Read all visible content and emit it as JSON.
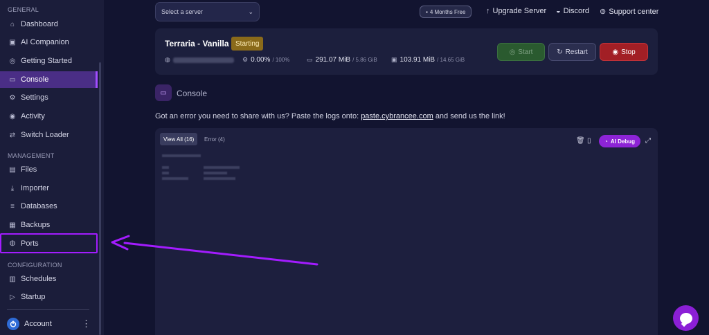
{
  "sidebar": {
    "section_general": "GENERAL",
    "section_management": "MANAGEMENT",
    "section_configuration": "CONFIGURATION",
    "general_items": [
      {
        "label": "Dashboard",
        "icon": "home-icon"
      },
      {
        "label": "AI Companion",
        "icon": "robot-icon"
      },
      {
        "label": "Getting Started",
        "icon": "compass-icon"
      },
      {
        "label": "Console",
        "icon": "terminal-icon"
      },
      {
        "label": "Settings",
        "icon": "gear-icon"
      },
      {
        "label": "Activity",
        "icon": "eye-icon"
      },
      {
        "label": "Switch Loader",
        "icon": "swap-icon"
      }
    ],
    "management_items": [
      {
        "label": "Files",
        "icon": "folder-icon"
      },
      {
        "label": "Importer",
        "icon": "download-icon"
      },
      {
        "label": "Databases",
        "icon": "database-icon"
      },
      {
        "label": "Backups",
        "icon": "archive-icon"
      },
      {
        "label": "Ports",
        "icon": "globe-icon"
      }
    ],
    "configuration_items": [
      {
        "label": "Schedules",
        "icon": "calendar-icon"
      },
      {
        "label": "Startup",
        "icon": "play-icon"
      }
    ],
    "account_label": "Account"
  },
  "topbar": {
    "server_select_placeholder": "Select a server",
    "free_badge": "4 Months Free",
    "upgrade": "Upgrade Server",
    "discord": "Discord",
    "support": "Support center"
  },
  "server": {
    "name": "Terraria - Vanilla",
    "status": "Starting",
    "cpu": "0.00%",
    "cpu_limit": "/ 100%",
    "memory": "291.07 MiB",
    "memory_limit": "/ 5.86 GiB",
    "disk": "103.91 MiB",
    "disk_limit": "/ 14.65 GiB",
    "start_label": "Start",
    "restart_label": "Restart",
    "stop_label": "Stop"
  },
  "console": {
    "title": "Console",
    "note_prefix": "Got an error you need to share with us? Paste the logs onto:",
    "note_link": "paste.cybrancee.com",
    "note_suffix": "and send us the link!",
    "tab_all": "View All (16)",
    "tab_error": "Error (4)",
    "ai_debug": "AI Debug"
  },
  "colors": {
    "accent": "#8d24d6",
    "highlight_outline": "#a31cff",
    "status_starting": "#8a6a1a",
    "start_green": "#2a5a2f",
    "stop_red": "#a21f25"
  }
}
